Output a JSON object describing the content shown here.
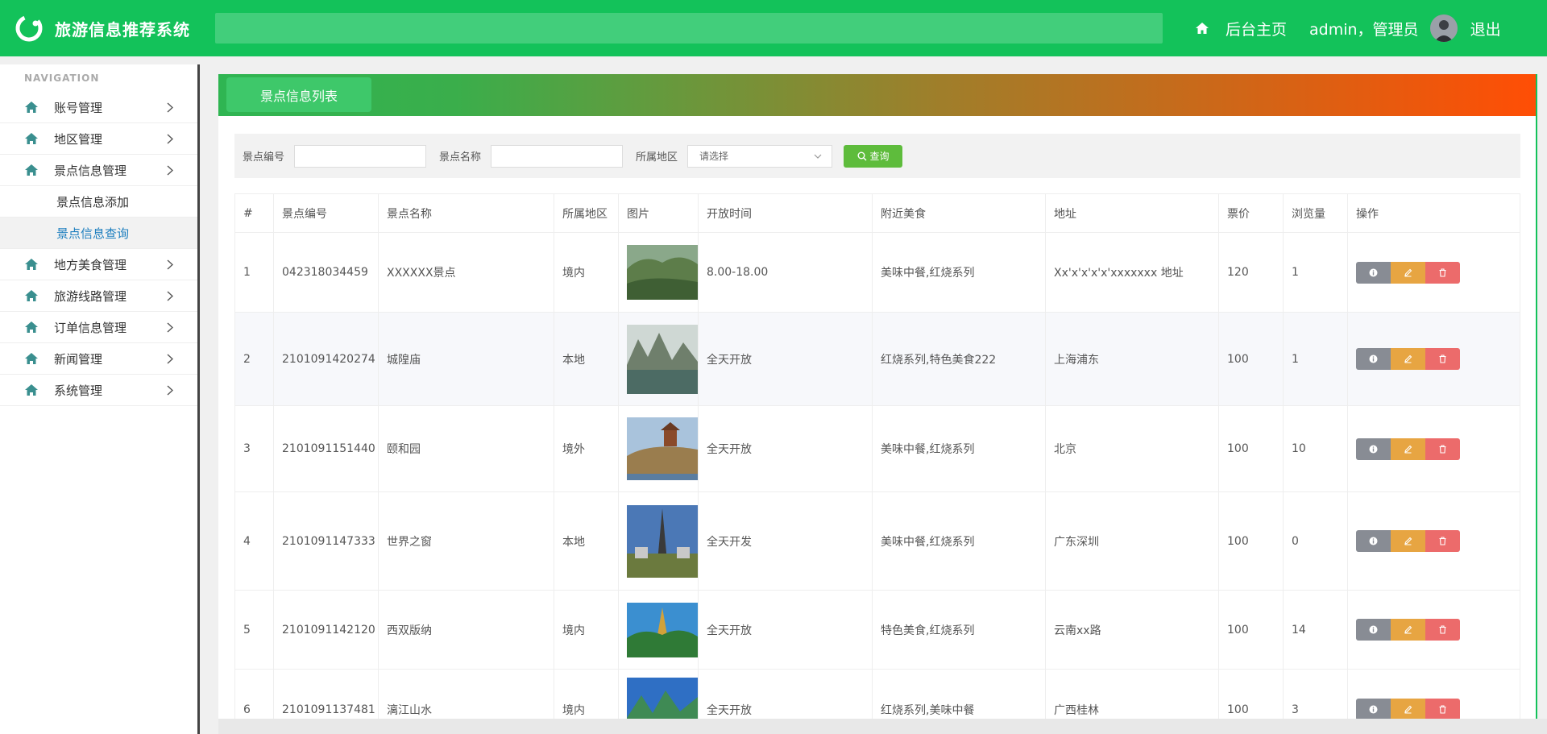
{
  "header": {
    "title": "旅游信息推荐系统",
    "home_label": "后台主页",
    "user_label": "admin，管理员",
    "logout_label": "退出",
    "brand_color": "#13c25a"
  },
  "sidebar": {
    "heading": "NAVIGATION",
    "items": [
      {
        "label": "账号管理",
        "icon": "home-icon"
      },
      {
        "label": "地区管理",
        "icon": "home-icon"
      },
      {
        "label": "景点信息管理",
        "icon": "home-icon"
      },
      {
        "label": "地方美食管理",
        "icon": "home-icon"
      },
      {
        "label": "旅游线路管理",
        "icon": "home-icon"
      },
      {
        "label": "订单信息管理",
        "icon": "home-icon"
      },
      {
        "label": "新闻管理",
        "icon": "home-icon"
      },
      {
        "label": "系统管理",
        "icon": "home-icon"
      }
    ],
    "subitems": [
      {
        "label": "景点信息添加"
      },
      {
        "label": "景点信息查询",
        "active": true
      }
    ]
  },
  "panel": {
    "tab_label": "景点信息列表"
  },
  "search": {
    "code_label": "景点编号",
    "name_label": "景点名称",
    "region_label": "所属地区",
    "region_placeholder": "请选择",
    "query_label": "查询"
  },
  "table": {
    "headers": [
      "#",
      "景点编号",
      "景点名称",
      "所属地区",
      "图片",
      "开放时间",
      "附近美食",
      "地址",
      "票价",
      "浏览量",
      "操作"
    ],
    "rows": [
      {
        "idx": "1",
        "code": "042318034459",
        "name": "XXXXXX景点",
        "region": "境内",
        "hours": "8.00-18.00",
        "food": "美味中餐,红烧系列",
        "address": "Xx'x'x'x'x'xxxxxxx 地址",
        "price": "120",
        "views": "1"
      },
      {
        "idx": "2",
        "code": "2101091420274",
        "name": "城隍庙",
        "region": "本地",
        "hours": "全天开放",
        "food": "红烧系列,特色美食222",
        "address": "上海浦东",
        "price": "100",
        "views": "1"
      },
      {
        "idx": "3",
        "code": "2101091151440",
        "name": "颐和园",
        "region": "境外",
        "hours": "全天开放",
        "food": "美味中餐,红烧系列",
        "address": "北京",
        "price": "100",
        "views": "10"
      },
      {
        "idx": "4",
        "code": "2101091147333",
        "name": "世界之窗",
        "region": "本地",
        "hours": "全天开发",
        "food": "美味中餐,红烧系列",
        "address": "广东深圳",
        "price": "100",
        "views": "0"
      },
      {
        "idx": "5",
        "code": "2101091142120",
        "name": "西双版纳",
        "region": "境内",
        "hours": "全天开放",
        "food": "特色美食,红烧系列",
        "address": "云南xx路",
        "price": "100",
        "views": "14"
      },
      {
        "idx": "6",
        "code": "2101091137481",
        "name": "漓江山水",
        "region": "境内",
        "hours": "全天开放",
        "food": "红烧系列,美味中餐",
        "address": "广西桂林",
        "price": "100",
        "views": "3"
      }
    ]
  }
}
